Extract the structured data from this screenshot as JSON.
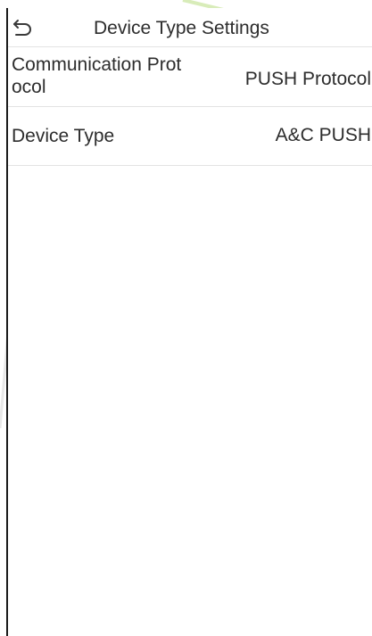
{
  "header": {
    "back_icon": "back-arrow-icon",
    "title": "Device Type Settings"
  },
  "settings": [
    {
      "label": "Communication Protocol",
      "value": "PUSH Protocol"
    },
    {
      "label": "Device Type",
      "value": "A&C PUSH"
    }
  ],
  "colors": {
    "background": "#ffffff",
    "text": "#2d2d2d",
    "divider": "#e3e3e3",
    "watermark": "#cfe8a8"
  }
}
